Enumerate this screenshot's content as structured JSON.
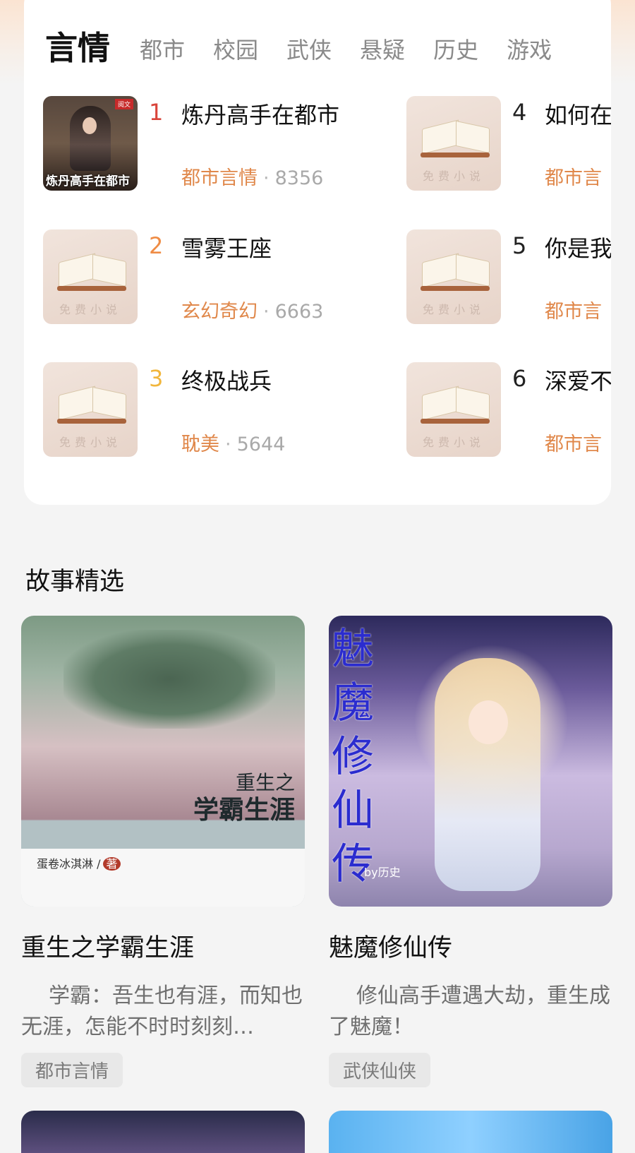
{
  "rank_tabs": [
    {
      "label": "言情",
      "active": true
    },
    {
      "label": "都市",
      "active": false
    },
    {
      "label": "校园",
      "active": false
    },
    {
      "label": "武侠",
      "active": false
    },
    {
      "label": "悬疑",
      "active": false
    },
    {
      "label": "历史",
      "active": false
    },
    {
      "label": "游戏",
      "active": false
    }
  ],
  "rank_list": [
    {
      "rank": "1",
      "title": "炼丹高手在都市",
      "genre": "都市言情",
      "score": "8356",
      "cover": "custom",
      "rank_color": "#d9453b",
      "cover_text": {
        "title": "炼丹高手在都市",
        "badge": "阅文"
      }
    },
    {
      "rank": "2",
      "title": "雪雾王座",
      "genre": "玄幻奇幻",
      "score": "6663",
      "cover": "default",
      "rank_color": "#ef8c45"
    },
    {
      "rank": "3",
      "title": "终极战兵",
      "genre": "耽美",
      "score": "5644",
      "cover": "default",
      "rank_color": "#f1b63c"
    },
    {
      "rank": "4",
      "title": "如何在",
      "genre": "都市言",
      "score": "",
      "cover": "default",
      "rank_color": "#222222"
    },
    {
      "rank": "5",
      "title": "你是我",
      "genre": "都市言",
      "score": "",
      "cover": "default",
      "rank_color": "#222222"
    },
    {
      "rank": "6",
      "title": "深爱不",
      "genre": "都市言",
      "score": "",
      "cover": "default",
      "rank_color": "#222222"
    }
  ],
  "default_cover_caption": "免费小说",
  "meta_separator": "·",
  "section": {
    "title": "故事精选"
  },
  "stories": [
    {
      "title": "重生之学霸生涯",
      "description": "学霸：吾生也有涯，而知也无涯，怎能不时时刻刻…",
      "tag": "都市言情",
      "cover": {
        "line1": "重生之",
        "line2": "学霸生涯",
        "author": "蛋卷冰淇淋 /",
        "author_tag": "著"
      }
    },
    {
      "title": "魅魔修仙传",
      "description": "修仙高手遭遇大劫，重生成了魅魔！",
      "tag": "武侠仙侠",
      "cover": {
        "title_text": "魅魔修仙传",
        "byline": "by历史"
      }
    }
  ],
  "colors": {
    "accent_orange": "#e0884b",
    "card_bg": "#ffffff",
    "page_bg": "#f4f4f4"
  }
}
